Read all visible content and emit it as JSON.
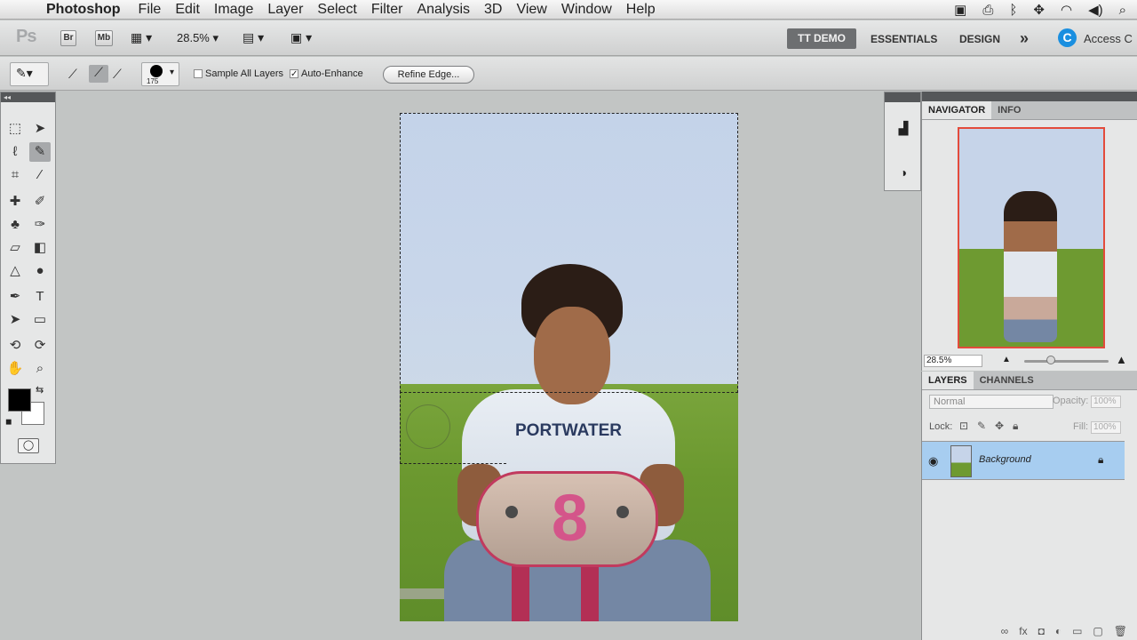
{
  "menubar": {
    "apple": "",
    "app": "Photoshop",
    "items": [
      "File",
      "Edit",
      "Image",
      "Layer",
      "Select",
      "Filter",
      "Analysis",
      "3D",
      "View",
      "Window",
      "Help"
    ]
  },
  "appbar": {
    "logo": "Ps",
    "bridge": "Br",
    "minibridge": "Mb",
    "zoom": "28.5%",
    "workspace_active": "TT DEMO",
    "workspace_essentials": "ESSENTIALS",
    "workspace_design": "DESIGN",
    "more": "»",
    "access": "Access C"
  },
  "options": {
    "brush_size": "175",
    "sample_all_layers": "Sample All Layers",
    "auto_enhance": "Auto-Enhance",
    "refine_edge": "Refine Edge..."
  },
  "canvas": {
    "shirt_text": "PORTWATER",
    "plate_number": "8"
  },
  "navigator": {
    "tab_navigator": "NAVIGATOR",
    "tab_info": "INFO",
    "zoom": "28.5%"
  },
  "layers": {
    "tab_layers": "LAYERS",
    "tab_channels": "CHANNELS",
    "blend_mode": "Normal",
    "opacity_label": "Opacity:",
    "opacity_value": "100%",
    "lock_label": "Lock:",
    "fill_label": "Fill:",
    "fill_value": "100%",
    "layer_name": "Background"
  },
  "colors": {
    "accent_selection": "#a7cdf0",
    "navigator_frame": "#e34b3b",
    "workspace_active_bg": "#6d6f71"
  }
}
